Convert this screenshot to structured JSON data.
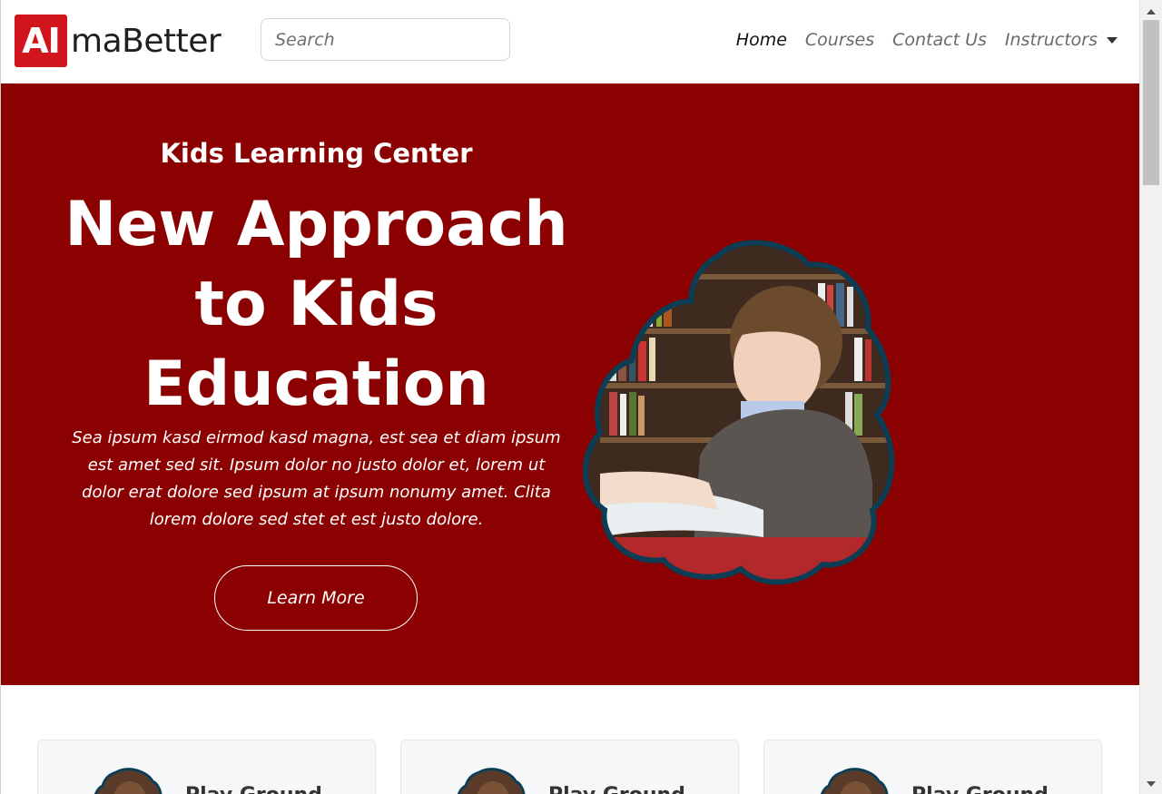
{
  "brand": {
    "logo_box_text": "AI",
    "logo_text": "maBetter",
    "accent_color": "#d0161c"
  },
  "search": {
    "placeholder": "Search"
  },
  "nav": {
    "items": [
      {
        "label": "Home",
        "active": true
      },
      {
        "label": "Courses",
        "active": false
      },
      {
        "label": "Contact Us",
        "active": false
      },
      {
        "label": "Instructors",
        "active": false,
        "dropdown": true
      }
    ]
  },
  "hero": {
    "background_color": "#8b0000",
    "subtitle": "Kids Learning Center",
    "title_line1": "New Approach",
    "title_line2": "to Kids",
    "title_line3": "Education",
    "text": "Sea ipsum kasd eirmod kasd magna, est sea et diam ipsum est amet sed sit. Ipsum dolor no justo dolor et, lorem ut dolor erat dolore sed ipsum at ipsum nonumy amet. Clita lorem dolore sed stet et est justo dolore.",
    "button_label": "Learn More",
    "image_icon": "child-reading-photo"
  },
  "cards": [
    {
      "title": "Play Ground"
    },
    {
      "title": "Play Ground"
    },
    {
      "title": "Play Ground"
    }
  ]
}
